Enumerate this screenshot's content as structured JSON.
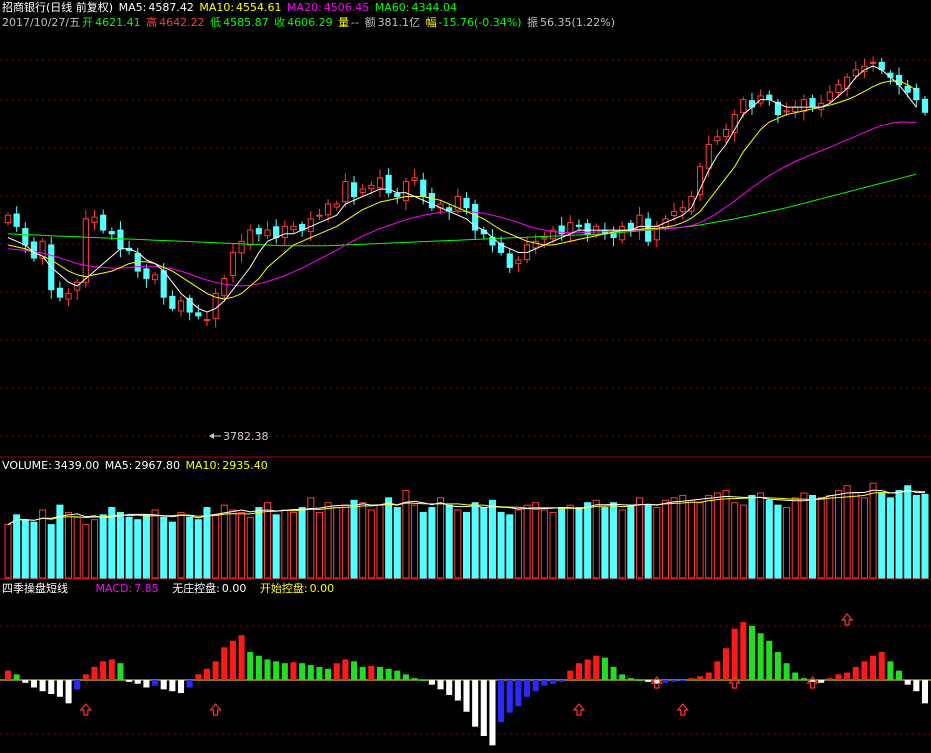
{
  "header": {
    "stock_title": "招商银行(日线 前复权)",
    "ma5_label": "MA5:",
    "ma5_value": "4587.42",
    "ma10_label": "MA10:",
    "ma10_value": "4554.61",
    "ma20_label": "MA20:",
    "ma20_value": "4506.45",
    "ma60_label": "MA60:",
    "ma60_value": "4344.04"
  },
  "quote": {
    "date": "2017/10/27/五",
    "open_label": "开",
    "open": "4621.41",
    "high_label": "高",
    "high": "4642.22",
    "low_label": "低",
    "low": "4585.87",
    "close_label": "收",
    "close": "4606.29",
    "volume_label": "量",
    "volume": "--",
    "amount_label": "额",
    "amount": "381.1亿",
    "change_label": "幅",
    "change": "-15.76(-0.34%)",
    "amplitude_label": "振",
    "amplitude": "56.35(1.22%)"
  },
  "low_marker": "3782.38",
  "volume_header": {
    "volume_label": "VOLUME:",
    "volume_value": "3439.00",
    "ma5_label": "MA5:",
    "ma5_value": "2967.80",
    "ma10_label": "MA10:",
    "ma10_value": "2935.40"
  },
  "macd_header": {
    "indicator_name": "四季操盘短线",
    "macd_label": "MACD:",
    "macd_value": "7.85",
    "item1_label": "无庄控盘:",
    "item1_value": "0.00",
    "item2_label": "开始控盘:",
    "item2_value": "0.00"
  },
  "colors": {
    "up": "#ff3b3b",
    "down": "#54ffff",
    "ma5": "#ffffff",
    "ma10": "#ffff00",
    "ma20": "#ff00ff",
    "ma60": "#00ff00",
    "grid": "#8b0000"
  },
  "chart_data": [
    {
      "type": "candlestick",
      "close": [
        4330,
        4300,
        4250,
        4215,
        4260,
        4130,
        4110,
        4120,
        4150,
        4320,
        4325,
        4290,
        4280,
        4240,
        4235,
        4180,
        4160,
        4170,
        4110,
        4080,
        4100,
        4070,
        4060,
        4050,
        4120,
        4160,
        4230,
        4260,
        4290,
        4280,
        4290,
        4270,
        4300,
        4300,
        4290,
        4320,
        4330,
        4360,
        4360,
        4420,
        4380,
        4400,
        4410,
        4430,
        4390,
        4380,
        4420,
        4430,
        4380,
        4350,
        4360,
        4340,
        4380,
        4350,
        4290,
        4280,
        4250,
        4230,
        4190,
        4210,
        4250,
        4260,
        4270,
        4290,
        4280,
        4310,
        4300,
        4280,
        4300,
        4280,
        4270,
        4300,
        4290,
        4330,
        4260,
        4300,
        4320,
        4340,
        4350,
        4380,
        4460,
        4520,
        4540,
        4560,
        4600,
        4640,
        4620,
        4650,
        4640,
        4600,
        4610,
        4620,
        4640,
        4620,
        4630,
        4660,
        4680,
        4700,
        4720,
        4730,
        4740,
        4720,
        4700,
        4680,
        4660,
        4640,
        4606
      ],
      "ma5": [
        4270,
        4260,
        4250,
        4230,
        4220,
        4190,
        4170,
        4150,
        4140,
        4160,
        4180,
        4200,
        4220,
        4240,
        4240,
        4230,
        4210,
        4200,
        4180,
        4150,
        4120,
        4100,
        4080,
        4070,
        4080,
        4100,
        4130,
        4160,
        4190,
        4230,
        4260,
        4270,
        4280,
        4280,
        4290,
        4300,
        4310,
        4320,
        4330,
        4360,
        4370,
        4380,
        4390,
        4400,
        4400,
        4390,
        4390,
        4380,
        4370,
        4360,
        4350,
        4340,
        4330,
        4320,
        4300,
        4290,
        4270,
        4250,
        4240,
        4230,
        4230,
        4240,
        4250,
        4260,
        4270,
        4280,
        4290,
        4290,
        4290,
        4290,
        4290,
        4290,
        4290,
        4300,
        4300,
        4300,
        4310,
        4320,
        4330,
        4350,
        4400,
        4450,
        4490,
        4520,
        4560,
        4600,
        4620,
        4640,
        4640,
        4630,
        4620,
        4620,
        4620,
        4620,
        4620,
        4630,
        4650,
        4670,
        4700,
        4720,
        4730,
        4720,
        4700,
        4680,
        4650,
        4620,
        4587
      ],
      "ma10": [
        4250,
        4245,
        4240,
        4230,
        4220,
        4210,
        4195,
        4180,
        4170,
        4165,
        4170,
        4175,
        4180,
        4190,
        4200,
        4205,
        4205,
        4200,
        4190,
        4180,
        4165,
        4150,
        4135,
        4120,
        4110,
        4105,
        4110,
        4120,
        4140,
        4160,
        4190,
        4210,
        4230,
        4250,
        4260,
        4270,
        4280,
        4290,
        4300,
        4315,
        4330,
        4345,
        4355,
        4365,
        4370,
        4375,
        4380,
        4380,
        4380,
        4375,
        4370,
        4360,
        4350,
        4340,
        4330,
        4320,
        4305,
        4290,
        4280,
        4270,
        4260,
        4255,
        4250,
        4250,
        4255,
        4260,
        4265,
        4270,
        4275,
        4280,
        4285,
        4288,
        4290,
        4292,
        4294,
        4295,
        4298,
        4302,
        4310,
        4322,
        4340,
        4370,
        4400,
        4430,
        4460,
        4500,
        4530,
        4560,
        4580,
        4590,
        4600,
        4605,
        4610,
        4615,
        4620,
        4625,
        4632,
        4640,
        4650,
        4662,
        4675,
        4685,
        4690,
        4690,
        4680,
        4665,
        4554
      ],
      "ma20": [
        4240,
        4238,
        4236,
        4232,
        4228,
        4222,
        4215,
        4208,
        4200,
        4195,
        4192,
        4190,
        4188,
        4188,
        4190,
        4192,
        4193,
        4193,
        4190,
        4186,
        4180,
        4172,
        4164,
        4156,
        4150,
        4145,
        4142,
        4140,
        4142,
        4146,
        4152,
        4160,
        4168,
        4178,
        4188,
        4200,
        4212,
        4224,
        4236,
        4250,
        4262,
        4274,
        4284,
        4294,
        4302,
        4310,
        4318,
        4324,
        4330,
        4334,
        4338,
        4340,
        4340,
        4340,
        4338,
        4335,
        4330,
        4324,
        4318,
        4310,
        4302,
        4295,
        4290,
        4286,
        4284,
        4283,
        4283,
        4284,
        4285,
        4286,
        4287,
        4288,
        4289,
        4290,
        4291,
        4292,
        4293,
        4295,
        4298,
        4302,
        4310,
        4322,
        4336,
        4352,
        4368,
        4386,
        4404,
        4420,
        4436,
        4450,
        4462,
        4474,
        4484,
        4494,
        4503,
        4512,
        4522,
        4532,
        4542,
        4552,
        4562,
        4570,
        4576,
        4580,
        4580,
        4578,
        4506
      ],
      "ma60": [
        4280,
        4279,
        4278,
        4277,
        4276,
        4275,
        4274,
        4273,
        4272,
        4271,
        4270,
        4269,
        4268,
        4267,
        4266,
        4265,
        4264,
        4263,
        4262,
        4261,
        4260,
        4259,
        4258,
        4257,
        4256,
        4255,
        4254,
        4253,
        4252,
        4251,
        4250,
        4249,
        4248,
        4248,
        4248,
        4248,
        4248,
        4248,
        4249,
        4250,
        4251,
        4252,
        4253,
        4254,
        4255,
        4256,
        4257,
        4258,
        4259,
        4260,
        4261,
        4262,
        4263,
        4264,
        4265,
        4266,
        4267,
        4268,
        4269,
        4270,
        4271,
        4272,
        4273,
        4274,
        4275,
        4276,
        4277,
        4278,
        4279,
        4280,
        4282,
        4284,
        4286,
        4288,
        4290,
        4292,
        4294,
        4296,
        4298,
        4300,
        4304,
        4308,
        4312,
        4316,
        4320,
        4325,
        4330,
        4335,
        4340,
        4345,
        4350,
        4356,
        4362,
        4368,
        4374,
        4380,
        4386,
        4392,
        4398,
        4404,
        4410,
        4416,
        4422,
        4428,
        4434,
        4440,
        4344
      ],
      "ylim": [
        3700,
        4800
      ]
    },
    {
      "type": "bar",
      "volume": [
        2200,
        2600,
        2400,
        2300,
        2800,
        2200,
        3000,
        2700,
        2500,
        2200,
        2400,
        2600,
        2900,
        2700,
        2500,
        2400,
        2600,
        2800,
        2500,
        2300,
        2700,
        2500,
        2400,
        2900,
        2600,
        3000,
        2800,
        2700,
        2500,
        2900,
        3100,
        2600,
        2800,
        2700,
        2900,
        3300,
        2700,
        3100,
        2900,
        3000,
        3200,
        3100,
        2800,
        3000,
        3300,
        2900,
        3600,
        3000,
        2700,
        2900,
        3300,
        3000,
        2800,
        2700,
        3100,
        2900,
        3200,
        2700,
        2600,
        2800,
        3000,
        3100,
        2800,
        2700,
        2900,
        3000,
        2900,
        3100,
        3200,
        2900,
        3100,
        2800,
        3000,
        3300,
        3000,
        2900,
        3200,
        3300,
        3400,
        3200,
        3100,
        3400,
        3500,
        3600,
        3100,
        3000,
        3400,
        3500,
        3200,
        3000,
        2900,
        3300,
        3500,
        3400,
        3300,
        3400,
        3600,
        3800,
        3500,
        3300,
        3900,
        3500,
        3300,
        3600,
        3800,
        3400,
        3439
      ],
      "ma5_value": 2967.8,
      "ma10_value": 2935.4,
      "ylim": [
        0,
        4200
      ]
    },
    {
      "type": "bar",
      "macd": [
        10,
        6,
        -3,
        -8,
        -12,
        -15,
        -18,
        -25,
        -10,
        6,
        14,
        20,
        22,
        18,
        -2,
        -4,
        -8,
        -6,
        -10,
        -12,
        -14,
        -8,
        6,
        12,
        20,
        35,
        42,
        48,
        30,
        26,
        22,
        20,
        18,
        19,
        18,
        16,
        14,
        12,
        18,
        22,
        20,
        14,
        15,
        14,
        12,
        10,
        6,
        2,
        0,
        -5,
        -10,
        -16,
        -22,
        -34,
        -50,
        -60,
        -70,
        -45,
        -35,
        -28,
        -18,
        -12,
        -6,
        -4,
        -2,
        10,
        18,
        22,
        26,
        24,
        14,
        6,
        2,
        0,
        -2,
        -4,
        -3,
        -2,
        -1,
        2,
        4,
        8,
        20,
        34,
        55,
        62,
        58,
        50,
        42,
        30,
        18,
        8,
        2,
        -2,
        -3,
        2,
        6,
        8,
        14,
        20,
        26,
        30,
        20,
        10,
        -5,
        -12,
        -25
      ],
      "ylim": [
        -75,
        75
      ]
    }
  ]
}
